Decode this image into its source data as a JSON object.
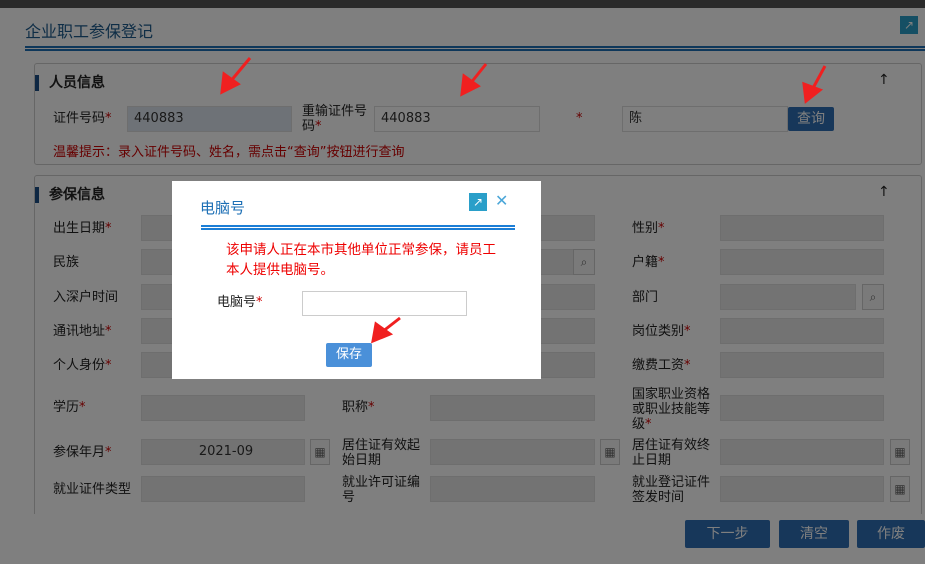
{
  "window": {
    "title": "企业职工参保登记"
  },
  "person": {
    "section_title": "人员信息",
    "id_label": "证件号码",
    "id_value": "440883",
    "reid_label": "重输证件号码",
    "reid_value": "440883",
    "name_value": "陈",
    "query_button": "查询",
    "hint": "温馨提示：录入证件号码、姓名，需点击“查询”按钮进行查询"
  },
  "insurance": {
    "section_title": "参保信息",
    "col1": [
      "出生日期",
      "民族",
      "入深户时间",
      "通讯地址",
      "个人身份"
    ],
    "col1_req": [
      true,
      false,
      false,
      true,
      true
    ],
    "col3": [
      "性别",
      "户籍",
      "部门",
      "岗位类别",
      "缴费工资"
    ],
    "col3_req": [
      true,
      true,
      false,
      true,
      true
    ],
    "edu_label": "学历",
    "title_label": "职称",
    "qual_label": "国家职业资格或职业技能等级",
    "month_label": "参保年月",
    "month_value": "2021-09",
    "res_start_label": "居住证有效起始日期",
    "res_end_label": "居住证有效终止日期",
    "emp_type_label": "就业证件类型",
    "permit_label": "就业许可证编号",
    "reg_date_label": "就业登记证件签发时间"
  },
  "footer": {
    "next": "下一步",
    "clear": "清空",
    "void": "作废"
  },
  "modal": {
    "title": "电脑号",
    "message": "该申请人正在本市其他单位正常参保，请员工本人提供电脑号。",
    "field_label": "电脑号",
    "field_value": "",
    "save": "保存"
  },
  "colors": {
    "accent": "#1c6fb5",
    "warning": "#e00000"
  }
}
